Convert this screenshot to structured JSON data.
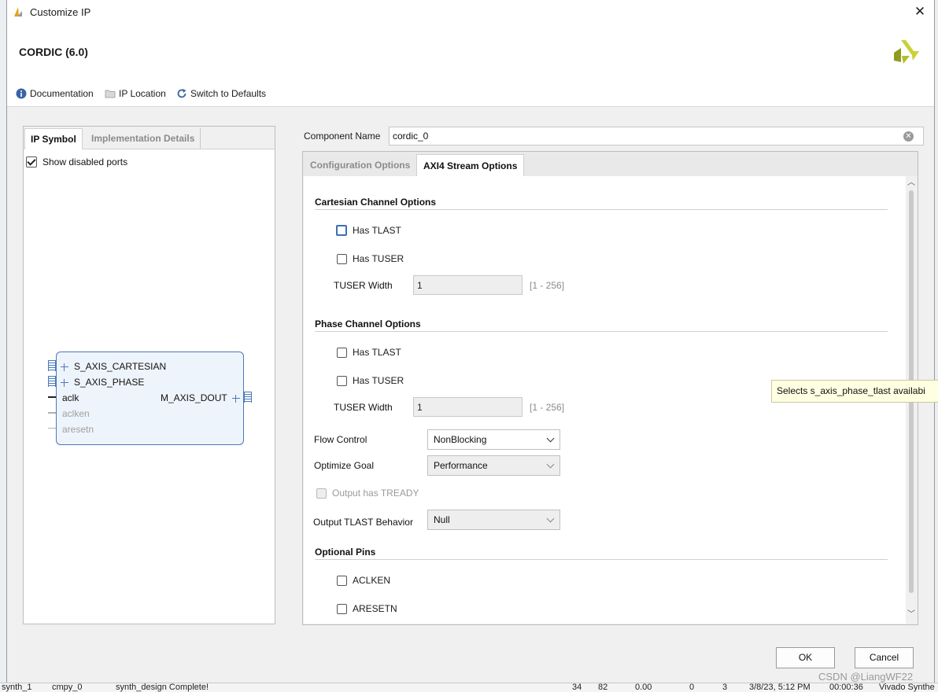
{
  "window": {
    "title": "Customize IP"
  },
  "ip": {
    "name": "CORDIC (6.0)"
  },
  "header_links": {
    "documentation": "Documentation",
    "ip_location": "IP Location",
    "switch_defaults": "Switch to Defaults"
  },
  "left_panel": {
    "tabs": [
      "IP Symbol",
      "Implementation Details"
    ],
    "show_disabled_ports": {
      "label": "Show disabled ports",
      "checked": true
    },
    "symbol": {
      "inputs": [
        "S_AXIS_CARTESIAN",
        "S_AXIS_PHASE",
        "aclk",
        "aclken",
        "aresetn"
      ],
      "output": "M_AXIS_DOUT"
    }
  },
  "component": {
    "label": "Component Name",
    "value": "cordic_0"
  },
  "right_tabs": [
    "Configuration Options",
    "AXI4 Stream Options"
  ],
  "cartesian": {
    "title": "Cartesian Channel Options",
    "has_tlast": "Has TLAST",
    "has_tuser": "Has TUSER",
    "tuser_width_label": "TUSER Width",
    "tuser_width_value": "1",
    "tuser_width_range": "[1 - 256]"
  },
  "phase": {
    "title": "Phase Channel Options",
    "has_tlast": "Has TLAST",
    "has_tuser": "Has TUSER",
    "tuser_width_label": "TUSER Width",
    "tuser_width_value": "1",
    "tuser_width_range": "[1 - 256]"
  },
  "flow_control": {
    "label": "Flow Control",
    "value": "NonBlocking"
  },
  "optimize_goal": {
    "label": "Optimize Goal",
    "value": "Performance"
  },
  "output_tready": {
    "label": "Output has TREADY"
  },
  "output_tlast": {
    "label": "Output TLAST Behavior",
    "value": "Null"
  },
  "optional_pins": {
    "title": "Optional Pins",
    "aclken": "ACLKEN",
    "aresetn": "ARESETN"
  },
  "tooltip": "Selects s_axis_phase_tlast availabi",
  "buttons": {
    "ok": "OK",
    "cancel": "Cancel"
  },
  "watermark": "CSDN @LiangWF22",
  "background_row": [
    "synth_1",
    "cmpy_0",
    "synth_design Complete!",
    "34",
    "82",
    "0.00",
    "0",
    "3",
    "3/8/23, 5:12 PM",
    "00:00:36",
    "Vivado Synthe"
  ],
  "colors": {
    "accent": "#4b79b8",
    "tooltip_bg": "#ffffe1",
    "xilinx_yellow": "#c8d237"
  }
}
